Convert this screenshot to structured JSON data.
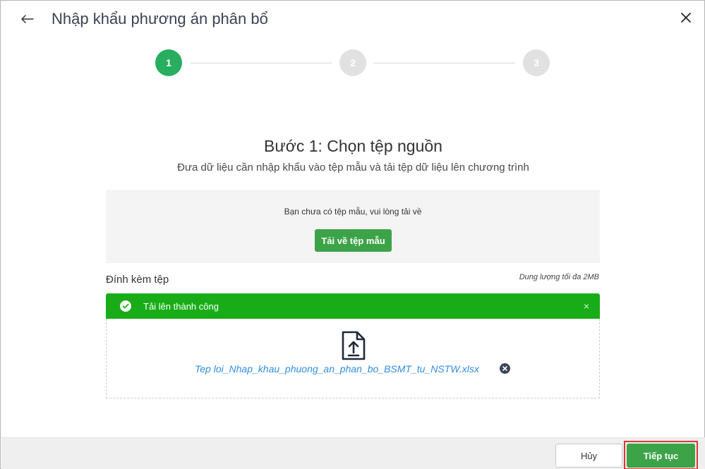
{
  "header": {
    "title": "Nhập khẩu phương án phân bổ",
    "back_icon": "arrow-left-icon",
    "close_icon": "close-icon"
  },
  "stepper": {
    "steps": [
      {
        "label": "1",
        "state": "active"
      },
      {
        "label": "2",
        "state": "inactive"
      },
      {
        "label": "3",
        "state": "inactive"
      }
    ],
    "colors": {
      "active": "#27ae60",
      "inactive": "#e1e1e1"
    }
  },
  "main": {
    "step_title": "Bước 1: Chọn tệp nguồn",
    "step_subtitle": "Đưa dữ liệu cần nhập khẩu vào tệp mẫu và tải tệp dữ liệu lên chương trình",
    "template": {
      "message": "Bạn chưa có tệp mẫu, vui lòng tải về",
      "download_label": "Tải về tệp mẫu"
    },
    "attachment": {
      "label": "Đính kèm tệp",
      "size_limit": "Dung lượng tối đa 2MB",
      "status_text": "Tải lên thành công",
      "status_color": "#18ad18",
      "file_name": "Tep loi_Nhap_khau_phuong_an_phan_bo_BSMT_tu_NSTW.xlsx",
      "upload_icon": "file-upload-icon",
      "remove_icon": "remove-file-icon"
    }
  },
  "footer": {
    "cancel_label": "Hủy",
    "next_label": "Tiếp tục",
    "accent": "#3ca348"
  }
}
